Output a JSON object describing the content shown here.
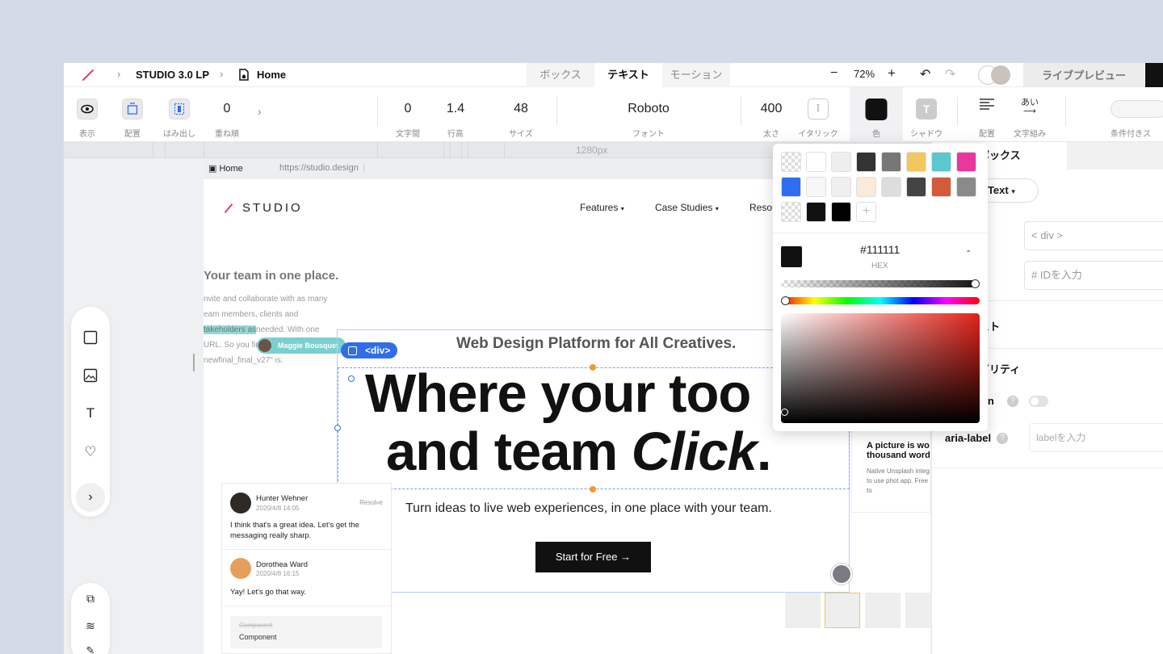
{
  "topbar": {
    "project": "STUDIO 3.0 LP",
    "page": "Home",
    "tabs": [
      "ボックス",
      "テキスト",
      "モーション"
    ],
    "zoom": "72%",
    "preview_label": "ライブプレビュー"
  },
  "toolbar": {
    "display": "表示",
    "placement": "配置",
    "overflow": "はみ出し",
    "order_value": "0",
    "order_label": "重ね順",
    "letter_spacing_value": "0",
    "letter_spacing_label": "文字間",
    "line_height_value": "1.4",
    "line_height_label": "行高",
    "size_value": "48",
    "size_label": "サイズ",
    "font_value": "Roboto",
    "font_label": "フォント",
    "weight_value": "400",
    "weight_label": "太さ",
    "italic_label": "イタリック",
    "color_label": "色",
    "shadow_label": "シャドウ",
    "align_label": "配置",
    "typeset_label": "文字組み",
    "conditional_label": "条件付きス",
    "typeset_glyph": "あい"
  },
  "ruler": {
    "width_label": "1280px"
  },
  "addressbar": {
    "page": "Home",
    "url": "https://studio.design"
  },
  "site": {
    "brand": "STUDIO",
    "nav": [
      "Features",
      "Case Studies",
      "Reso"
    ],
    "side_heading": "Your team in one place.",
    "side_text_before": "nvite and collaborate with as many eam members, clients and ",
    "side_text_mark": "takeholders as",
    "side_text_after": "needed. With one URL. So you fin keep track of where newfinal_final_v27\" is.",
    "cursor_user": "Maggie Bousquet",
    "div_tag": "<div>",
    "subheading": "Web Design Platform for All Creatives.",
    "headline_line1": "Where your too",
    "headline_line2_a": "and team ",
    "headline_line2_em": "Click",
    "headline_line2_b": ".",
    "lead": "Turn ideas to live web experiences, in one place with your team.",
    "cta": "Start for Free →",
    "card_title": "A picture is wo thousand word",
    "card_desc": "Native Unsplash integ Find ready to use phot app. Free of charge to"
  },
  "comments": [
    {
      "name": "Hunter Wehner",
      "date": "2020/4/8 14:05",
      "text": "I think that's a great idea. Let's get the messaging really sharp.",
      "action": "Resolve"
    },
    {
      "name": "Dorothea Ward",
      "date": "2020/4/8 16:15",
      "text": "Yay! Let's go that way."
    }
  ],
  "component": {
    "struck": "Component",
    "label": "Component"
  },
  "color_picker": {
    "swatches_row1": [
      "transparent",
      "#ffffff",
      "#eeeeee",
      "#333333",
      "#777777",
      "#f2c760",
      "#5bc8cf",
      "#e8379f"
    ],
    "swatches_row2": [
      "#2f6ef0",
      "#f7f7f7",
      "#efefef",
      "#f9eada",
      "#dddddd",
      "#444444",
      "#d35b39",
      "#8a8a8a"
    ],
    "swatches_row3": [
      "transparent",
      "#111111",
      "#000000"
    ],
    "hex_value": "#111111",
    "hex_label": "HEX",
    "current_color": "#111111"
  },
  "right_panel": {
    "tab": "ボックス",
    "element_type": "nText",
    "tag_value": "< div >",
    "id_placeholder": "#  IDを入力",
    "section_text": "スト",
    "section_a11y": "ビリティ",
    "hidden_label": "len",
    "aria_label": "aria-label",
    "aria_placeholder": "labelを入力"
  }
}
